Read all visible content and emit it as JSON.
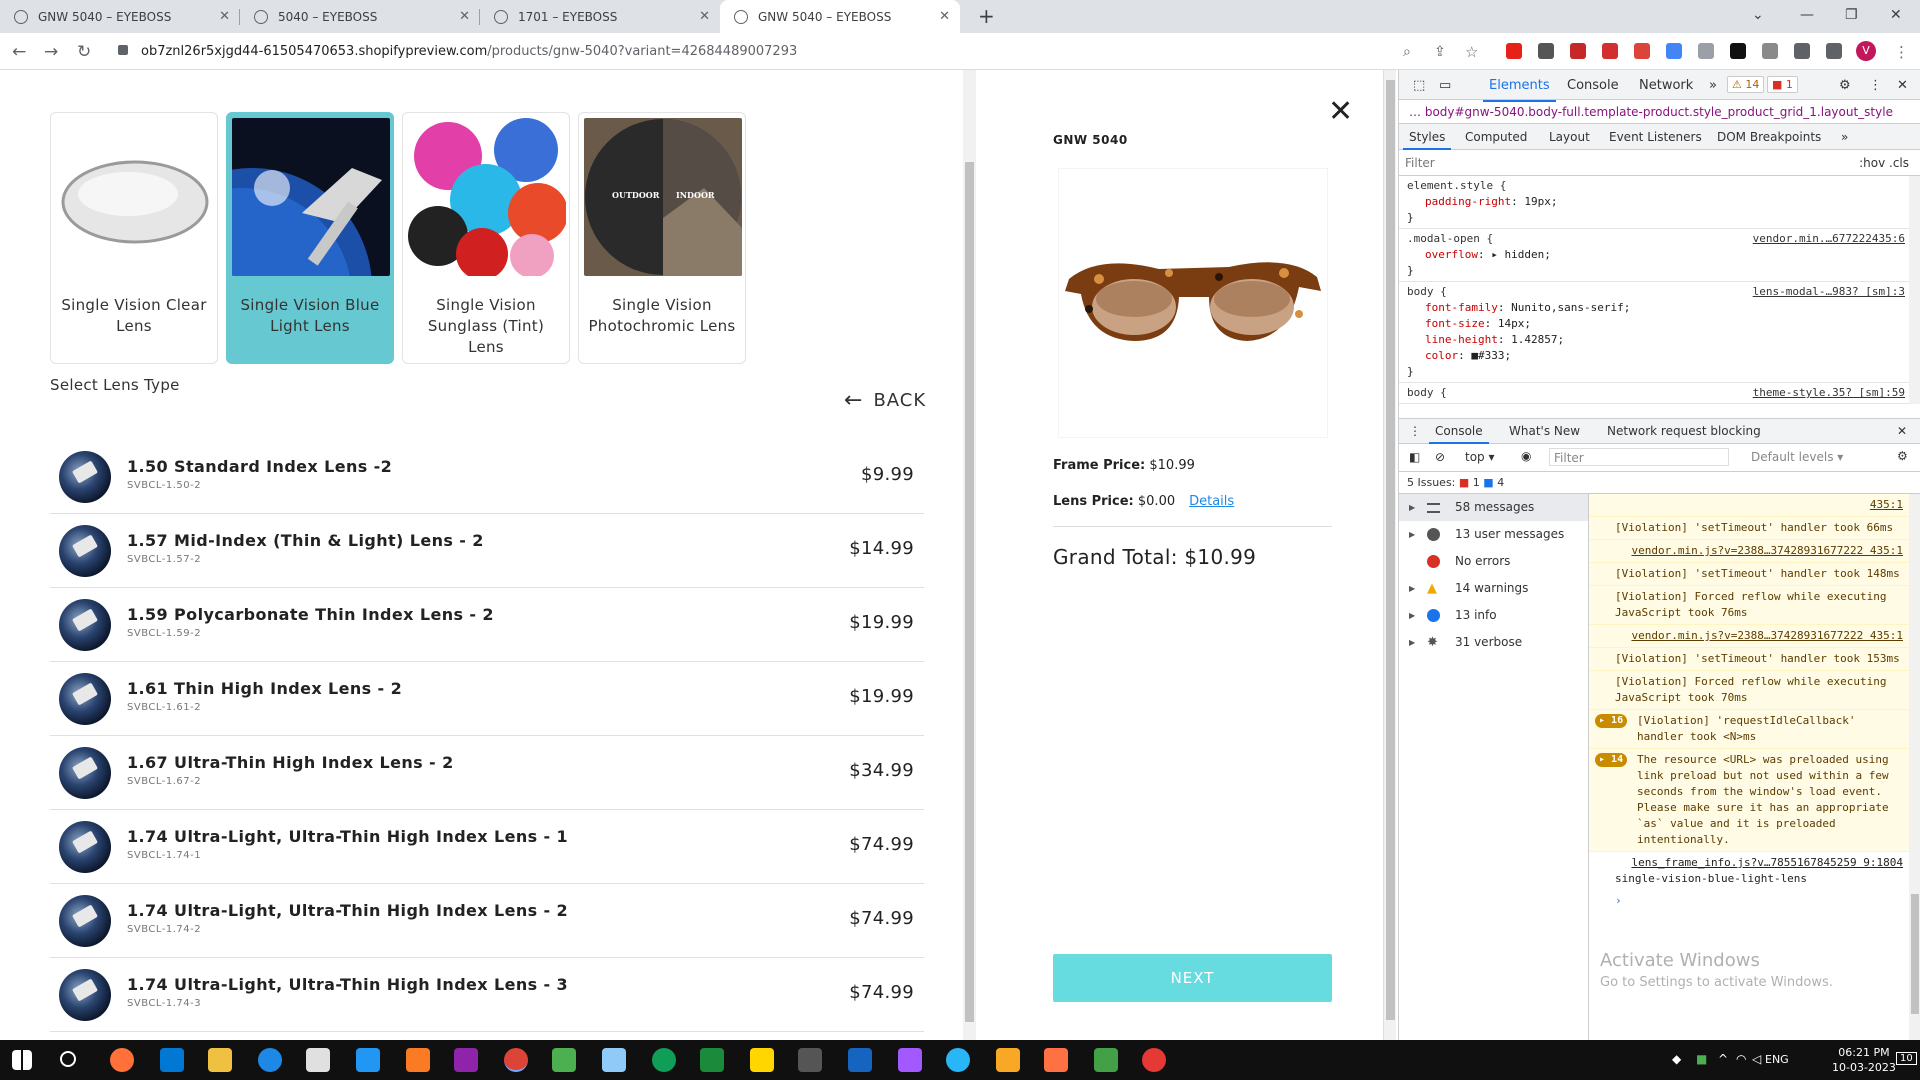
{
  "browser": {
    "tabs": [
      {
        "title": "GNW 5040 – EYEBOSS",
        "active": false
      },
      {
        "title": "5040 – EYEBOSS",
        "active": false
      },
      {
        "title": "1701 – EYEBOSS",
        "active": false
      },
      {
        "title": "GNW 5040 – EYEBOSS",
        "active": true
      }
    ],
    "url_host": "ob7znl26r5xjgd44-61505470653.shopifypreview.com",
    "url_path": "/products/gnw-5040?variant=42684489007293",
    "avatar_letter": "V"
  },
  "lens_categories": [
    {
      "label": "Single Vision Clear Lens",
      "selected": false
    },
    {
      "label": "Single Vision Blue Light Lens",
      "selected": true
    },
    {
      "label": "Single Vision Sunglass (Tint) Lens",
      "selected": false
    },
    {
      "label": "Single Vision Photochromic Lens",
      "selected": false
    }
  ],
  "photochromic_labels": {
    "left": "OUTDOOR",
    "right": "INDOOR"
  },
  "select_heading": "Select Lens Type",
  "back_label": "BACK",
  "lenses": [
    {
      "name": "1.50 Standard Index Lens -2",
      "code": "SVBCL-1.50-2",
      "price": "$9.99"
    },
    {
      "name": "1.57 Mid-Index (Thin & Light) Lens - 2",
      "code": "SVBCL-1.57-2",
      "price": "$14.99"
    },
    {
      "name": "1.59 Polycarbonate Thin Index Lens - 2",
      "code": "SVBCL-1.59-2",
      "price": "$19.99"
    },
    {
      "name": "1.61 Thin High Index Lens - 2",
      "code": "SVBCL-1.61-2",
      "price": "$19.99"
    },
    {
      "name": "1.67 Ultra-Thin High Index Lens - 2",
      "code": "SVBCL-1.67-2",
      "price": "$34.99"
    },
    {
      "name": "1.74 Ultra-Light, Ultra-Thin High Index Lens - 1",
      "code": "SVBCL-1.74-1",
      "price": "$74.99"
    },
    {
      "name": "1.74 Ultra-Light, Ultra-Thin High Index Lens - 2",
      "code": "SVBCL-1.74-2",
      "price": "$74.99"
    },
    {
      "name": "1.74 Ultra-Light, Ultra-Thin High Index Lens - 3",
      "code": "SVBCL-1.74-3",
      "price": "$74.99"
    }
  ],
  "summary": {
    "product_title": "GNW 5040",
    "frame_price_label": "Frame Price:",
    "frame_price": "$10.99",
    "lens_price_label": "Lens Price:",
    "lens_price": "$0.00",
    "details_link": "Details",
    "grand_total": "Grand Total: $10.99",
    "next_label": "NEXT"
  },
  "devtools": {
    "tabs": [
      "Elements",
      "Console",
      "Network"
    ],
    "warn_count": "14",
    "err_count": "1",
    "breadcrumb": "body#gnw-5040.body-full.template-product.style_product_grid_1.layout_style",
    "style_tabs": [
      "Styles",
      "Computed",
      "Layout",
      "Event Listeners",
      "DOM Breakpoints"
    ],
    "filter_placeholder": "Filter",
    "filter_tools": ":hov .cls",
    "rules": [
      {
        "selector": "element.style {",
        "source": "",
        "props": [
          [
            "padding-right",
            "19px;"
          ]
        ]
      },
      {
        "selector": ".modal-open {",
        "source": "vendor.min.…677222435:6",
        "props": [
          [
            "overflow",
            "▸ hidden;"
          ]
        ]
      },
      {
        "selector": "body {",
        "source": "lens-modal-…983? [sm]:3",
        "props": [
          [
            "font-family",
            "Nunito,sans-serif;"
          ],
          [
            "font-size",
            "14px;"
          ],
          [
            "line-height",
            "1.42857;"
          ],
          [
            "color",
            "■#333;"
          ]
        ]
      },
      {
        "selector": "body {",
        "source": "theme-style.35? [sm]:59",
        "props": []
      }
    ],
    "drawer_tabs": [
      "Console",
      "What's New",
      "Network request blocking"
    ],
    "context": "top",
    "console_filter": "Filter",
    "levels": "Default levels",
    "issues": "5 Issues:",
    "issues_err": "1",
    "issues_info": "4",
    "sidebar": [
      {
        "label": "58 messages",
        "icon": "list-icon"
      },
      {
        "label": "13 user messages",
        "icon": "user-icon"
      },
      {
        "label": "No errors",
        "icon": "error-icon"
      },
      {
        "label": "14 warnings",
        "icon": "warning-icon"
      },
      {
        "label": "13 info",
        "icon": "info-icon"
      },
      {
        "label": "31 verbose",
        "icon": "bug-icon"
      }
    ],
    "messages": [
      {
        "link": "435:1",
        "text": ""
      },
      {
        "link": "",
        "text": "[Violation] 'setTimeout' handler took 66ms"
      },
      {
        "link": "vendor.min.js?v=2388…37428931677222 435:1",
        "text": ""
      },
      {
        "link": "",
        "text": "[Violation] 'setTimeout' handler took 148ms"
      },
      {
        "link": "",
        "text": "[Violation] Forced reflow while executing JavaScript took 76ms"
      },
      {
        "link": "vendor.min.js?v=2388…37428931677222 435:1",
        "text": ""
      },
      {
        "link": "",
        "text": "[Violation] 'setTimeout' handler took 153ms"
      },
      {
        "link": "",
        "text": "[Violation] Forced reflow while executing JavaScript took 70ms"
      }
    ],
    "grouped": [
      {
        "count": "16",
        "text": "[Violation] 'requestIdleCallback' handler took <N>ms"
      },
      {
        "count": "14",
        "text": "The resource <URL> was preloaded using link preload but not used within a few seconds from the window's load event. Please make sure it has an appropriate `as` value and it is preloaded intentionally."
      }
    ],
    "last_link": "lens_frame_info.js?v…7855167845259 9:1804",
    "last_output": "single-vision-blue-light-lens"
  },
  "watermark": {
    "title": "Activate Windows",
    "sub": "Go to Settings to activate Windows."
  },
  "taskbar": {
    "lang": "ENG",
    "time": "06:21 PM",
    "date": "10-03-2023",
    "notif": "10"
  }
}
